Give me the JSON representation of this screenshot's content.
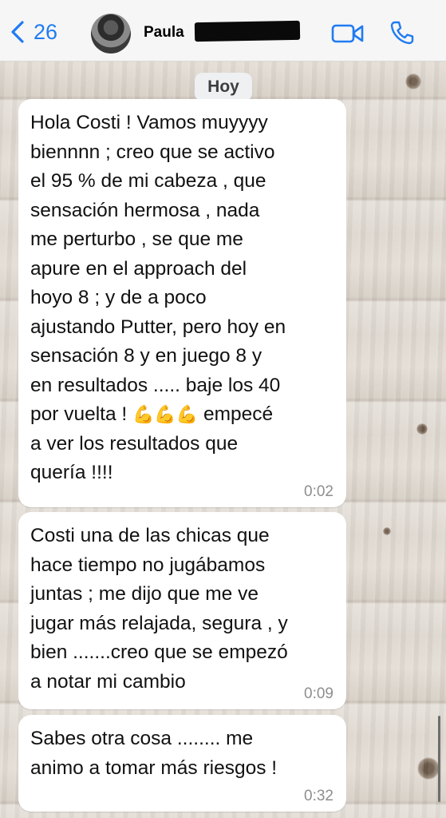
{
  "header": {
    "back_count": "26",
    "contact_name": "Paula",
    "icons": {
      "back": "chevron-left-icon",
      "video": "video-camera-icon",
      "call": "phone-icon"
    },
    "accent_color": "#1f7bf2"
  },
  "chat": {
    "date_separator": "Hoy",
    "messages": [
      {
        "text": "Hola Costi ! Vamos muyyyy\nbiennnn ; creo que se activo\nel 95 % de mi cabeza , que\nsensación hermosa , nada\nme perturbo , se que me\napure en el approach del\nhoyo 8 ; y de a poco\najustando Putter, pero hoy en\nsensación 8 y en juego 8 y\nen resultados ..... baje los 40\npor vuelta ! ",
        "emoji": "💪💪💪",
        "text_after": " empecé\na ver los resultados que\nquería !!!!",
        "time": "0:02"
      },
      {
        "text": "Costi una de las chicas que\nhace tiempo no jugábamos\njuntas ; me dijo que me ve\njugar más relajada, segura , y\nbien .......creo que se empezó\na notar mi cambio",
        "time": "0:09"
      },
      {
        "text": "Sabes otra cosa ........ me\nanimo a tomar más riesgos !",
        "time": "0:32"
      }
    ]
  }
}
